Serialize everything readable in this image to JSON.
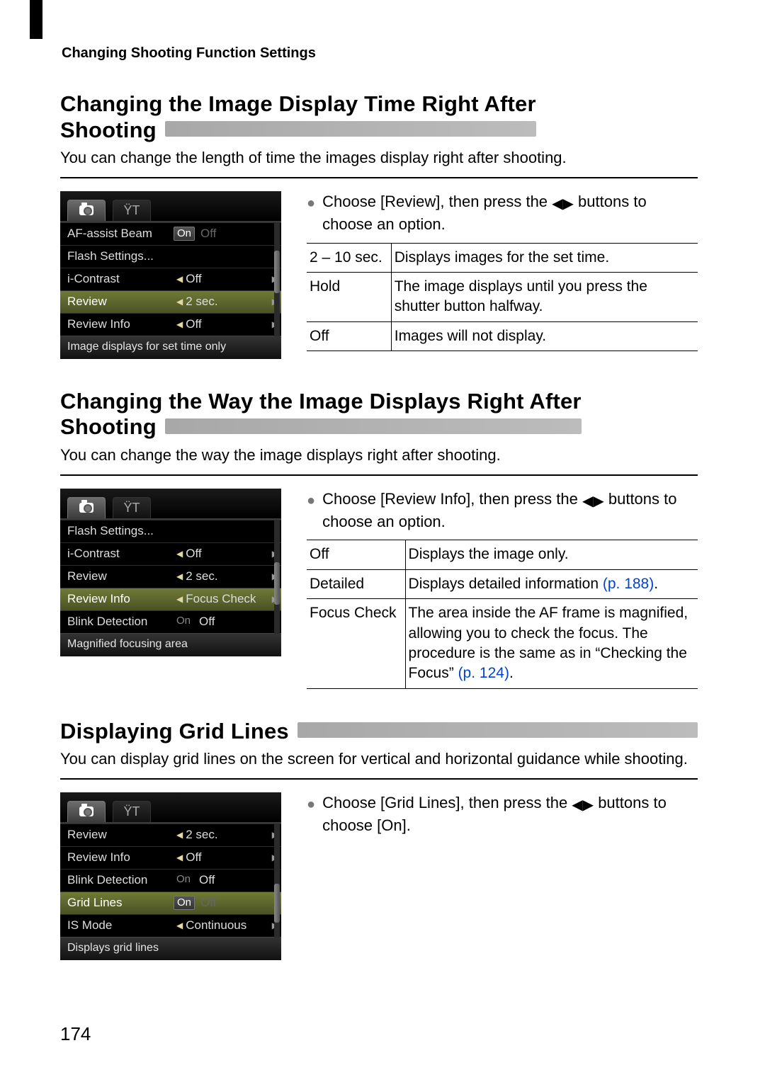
{
  "running_header": "Changing Shooting Function Settings",
  "page_number": "174",
  "sec1": {
    "title_line1": "Changing the Image Display Time Right After",
    "title_line2": "Shooting",
    "intro": "You can change the length of time the images display right after shooting.",
    "bullet_a": "Choose [Review], then press the ",
    "bullet_b": " buttons to choose an option.",
    "table": {
      "r0c0": "2 – 10 sec.",
      "r0c1": "Displays images for the set time.",
      "r1c0": "Hold",
      "r1c1": "The image displays until you press the shutter button halfway.",
      "r2c0": "Off",
      "r2c1": "Images will not display."
    },
    "menu": {
      "row0": {
        "label": "AF-assist Beam",
        "val_on": "On",
        "val_off": "Off"
      },
      "row1": {
        "label": "Flash Settings...",
        "val": ""
      },
      "row2": {
        "label": "i-Contrast",
        "val": "Off"
      },
      "row3": {
        "label": "Review",
        "val": "2 sec."
      },
      "row4": {
        "label": "Review Info",
        "val": "Off"
      },
      "hint": "Image displays for set time only"
    }
  },
  "sec2": {
    "title_line1": "Changing the Way the Image Displays Right After",
    "title_line2": "Shooting",
    "intro": "You can change the way the image displays right after shooting.",
    "bullet_a": "Choose [Review Info], then press the ",
    "bullet_b": " buttons to choose an option.",
    "table": {
      "r0c0": "Off",
      "r0c1": "Displays the image only.",
      "r1c0": "Detailed",
      "r1c1a": "Displays detailed information ",
      "r1c1b": "(p. 188)",
      "r1c1c": ".",
      "r2c0": "Focus Check",
      "r2c1a": "The area inside the AF frame is magnified, allowing you to check the focus. The procedure is the same as in “Checking the Focus” ",
      "r2c1b": "(p. 124)",
      "r2c1c": "."
    },
    "menu": {
      "row0": {
        "label": "Flash Settings...",
        "val": ""
      },
      "row1": {
        "label": "i-Contrast",
        "val": "Off"
      },
      "row2": {
        "label": "Review",
        "val": "2 sec."
      },
      "row3": {
        "label": "Review Info",
        "val": "Focus Check"
      },
      "row4": {
        "label": "Blink Detection",
        "val_on": "On",
        "val_off": "Off"
      },
      "hint": "Magnified focusing area"
    }
  },
  "sec3": {
    "title": "Displaying Grid Lines",
    "intro": "You can display grid lines on the screen for vertical and horizontal guidance while shooting.",
    "bullet_a": "Choose [Grid Lines], then press the ",
    "bullet_b": " buttons to choose [On].",
    "menu": {
      "row0": {
        "label": "Review",
        "val": "2 sec."
      },
      "row1": {
        "label": "Review Info",
        "val": "Off"
      },
      "row2": {
        "label": "Blink Detection",
        "val_on": "On",
        "val_off": "Off"
      },
      "row3": {
        "label": "Grid Lines",
        "val_on": "On",
        "val_off": "Off"
      },
      "row4": {
        "label": "IS Mode",
        "val": "Continuous"
      },
      "hint": "Displays grid lines"
    }
  }
}
